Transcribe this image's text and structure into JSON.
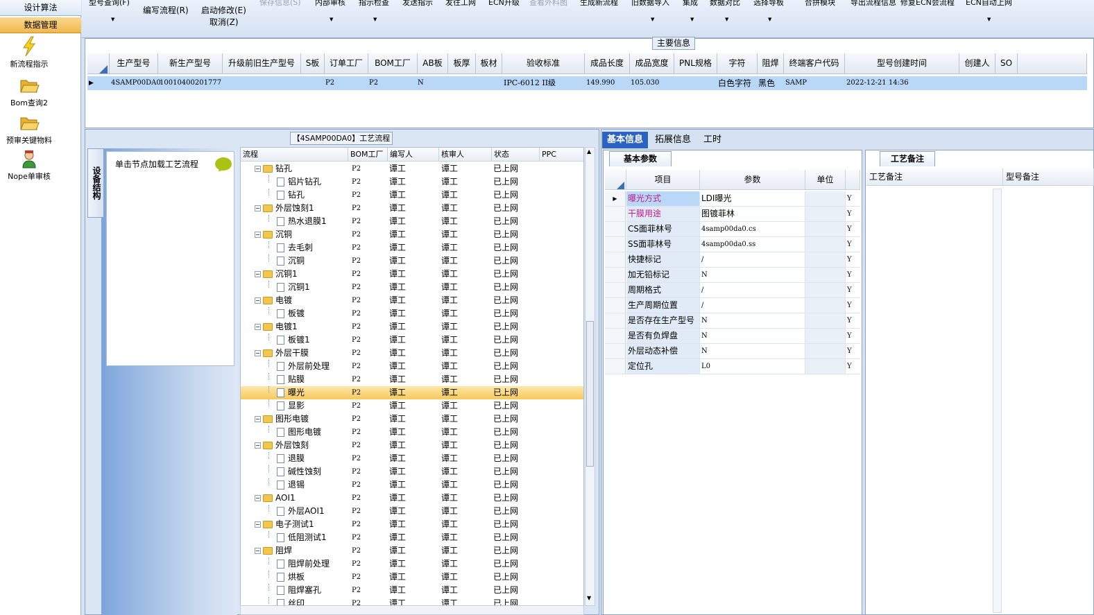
{
  "sidebar": {
    "tabs": [
      "设计算法",
      "数据管理"
    ],
    "items": [
      {
        "label": "新流程指示",
        "icon": "lightning-icon"
      },
      {
        "label": "Bom查询2",
        "icon": "folder-open-icon"
      },
      {
        "label": "预审关键物料",
        "icon": "folder-open-icon"
      },
      {
        "label": "Nope单审核",
        "icon": "user-icon"
      }
    ]
  },
  "toolbar": {
    "top_row": [
      "型号查询(F)",
      "保存信息(S)",
      "内部审核",
      "指示检查",
      "发送指示",
      "发往工网",
      "ECN升级",
      "查看外料图",
      "生成新流程",
      "旧数据导入",
      "集成",
      "数据对比",
      "选择导板",
      "合拼模块",
      "导出流程信息",
      "修复ECN会流程",
      "ECN自动上网"
    ],
    "main_row": [
      "编写流程(R)",
      "启动修改(E)",
      "取消(Z)"
    ]
  },
  "main_info": {
    "title": "主要信息",
    "columns": [
      "生产型号",
      "新生产型号",
      "升级前旧生产型号",
      "S板",
      "订单工厂",
      "BOM工厂",
      "AB板",
      "板厚",
      "板材",
      "验收标准",
      "成品长度",
      "成品宽度",
      "PNL规格",
      "字符",
      "阻焊",
      "终端客户代码",
      "型号创建时间",
      "创建人",
      "SO"
    ],
    "row": {
      "生产型号": "4SAMP00DA0",
      "新生产型号": "10010400201777",
      "升级前旧生产型号": "",
      "S板": "",
      "订单工厂": "P2",
      "BOM工厂": "P2",
      "AB板": "N",
      "板厚": "",
      "板材": "",
      "验收标准": "IPC-6012 II级",
      "成品长度": "149.990",
      "成品宽度": "105.030",
      "PNL规格": "",
      "字符": "白色字符",
      "阻焊": "黑色",
      "终端客户代码": "SAMP",
      "型号创建时间": "2022-12-21 14:36",
      "创建人": "",
      "SO": ""
    }
  },
  "process": {
    "title": "【4SAMP00DA0】工艺流程",
    "vertical_tab": "设备结构",
    "load_hint": "单击节点加载工艺流程",
    "columns": [
      "流程",
      "BOM工厂",
      "编写人",
      "核审人",
      "状态",
      "PPC"
    ],
    "rows": [
      {
        "name": "钻孔",
        "type": "folder",
        "bom": "P2",
        "writer": "谭工",
        "reviewer": "谭工",
        "status": "已上网"
      },
      {
        "name": "铝片钻孔",
        "type": "doc",
        "bom": "P2",
        "writer": "谭工",
        "reviewer": "谭工",
        "status": "已上网"
      },
      {
        "name": "钻孔",
        "type": "doc",
        "bom": "P2",
        "writer": "谭工",
        "reviewer": "谭工",
        "status": "已上网"
      },
      {
        "name": "外层蚀刻1",
        "type": "folder",
        "bom": "P2",
        "writer": "谭工",
        "reviewer": "谭工",
        "status": "已上网"
      },
      {
        "name": "热水退膜1",
        "type": "doc",
        "bom": "P2",
        "writer": "谭工",
        "reviewer": "谭工",
        "status": "已上网"
      },
      {
        "name": "沉铜",
        "type": "folder",
        "bom": "P2",
        "writer": "谭工",
        "reviewer": "谭工",
        "status": "已上网"
      },
      {
        "name": "去毛刺",
        "type": "doc",
        "bom": "P2",
        "writer": "谭工",
        "reviewer": "谭工",
        "status": "已上网"
      },
      {
        "name": "沉铜",
        "type": "doc",
        "bom": "P2",
        "writer": "谭工",
        "reviewer": "谭工",
        "status": "已上网"
      },
      {
        "name": "沉铜1",
        "type": "folder",
        "bom": "P2",
        "writer": "谭工",
        "reviewer": "谭工",
        "status": "已上网"
      },
      {
        "name": "沉铜1",
        "type": "doc",
        "bom": "P2",
        "writer": "谭工",
        "reviewer": "谭工",
        "status": "已上网"
      },
      {
        "name": "电镀",
        "type": "folder",
        "bom": "P2",
        "writer": "谭工",
        "reviewer": "谭工",
        "status": "已上网"
      },
      {
        "name": "板镀",
        "type": "doc",
        "bom": "P2",
        "writer": "谭工",
        "reviewer": "谭工",
        "status": "已上网"
      },
      {
        "name": "电镀1",
        "type": "folder",
        "bom": "P2",
        "writer": "谭工",
        "reviewer": "谭工",
        "status": "已上网"
      },
      {
        "name": "板镀1",
        "type": "doc",
        "bom": "P2",
        "writer": "谭工",
        "reviewer": "谭工",
        "status": "已上网"
      },
      {
        "name": "外层干膜",
        "type": "folder",
        "bom": "P2",
        "writer": "谭工",
        "reviewer": "谭工",
        "status": "已上网"
      },
      {
        "name": "外层前处理",
        "type": "doc",
        "bom": "P2",
        "writer": "谭工",
        "reviewer": "谭工",
        "status": "已上网"
      },
      {
        "name": "贴膜",
        "type": "doc",
        "bom": "P2",
        "writer": "谭工",
        "reviewer": "谭工",
        "status": "已上网"
      },
      {
        "name": "曝光",
        "type": "doc",
        "bom": "P2",
        "writer": "谭工",
        "reviewer": "谭工",
        "status": "已上网",
        "selected": true
      },
      {
        "name": "显影",
        "type": "doc",
        "bom": "P2",
        "writer": "谭工",
        "reviewer": "谭工",
        "status": "已上网"
      },
      {
        "name": "图形电镀",
        "type": "folder",
        "bom": "P2",
        "writer": "谭工",
        "reviewer": "谭工",
        "status": "已上网"
      },
      {
        "name": "图形电镀",
        "type": "doc",
        "bom": "P2",
        "writer": "谭工",
        "reviewer": "谭工",
        "status": "已上网"
      },
      {
        "name": "外层蚀刻",
        "type": "folder",
        "bom": "P2",
        "writer": "谭工",
        "reviewer": "谭工",
        "status": "已上网"
      },
      {
        "name": "退膜",
        "type": "doc",
        "bom": "P2",
        "writer": "谭工",
        "reviewer": "谭工",
        "status": "已上网"
      },
      {
        "name": "碱性蚀刻",
        "type": "doc",
        "bom": "P2",
        "writer": "谭工",
        "reviewer": "谭工",
        "status": "已上网"
      },
      {
        "name": "退锡",
        "type": "doc",
        "bom": "P2",
        "writer": "谭工",
        "reviewer": "谭工",
        "status": "已上网"
      },
      {
        "name": "AOI1",
        "type": "folder",
        "bom": "P2",
        "writer": "谭工",
        "reviewer": "谭工",
        "status": "已上网"
      },
      {
        "name": "外层AOI1",
        "type": "doc",
        "bom": "P2",
        "writer": "谭工",
        "reviewer": "谭工",
        "status": "已上网"
      },
      {
        "name": "电子测试1",
        "type": "folder",
        "bom": "P2",
        "writer": "谭工",
        "reviewer": "谭工",
        "status": "已上网"
      },
      {
        "name": "低阻测试1",
        "type": "doc",
        "bom": "P2",
        "writer": "谭工",
        "reviewer": "谭工",
        "status": "已上网"
      },
      {
        "name": "阻焊",
        "type": "folder",
        "bom": "P2",
        "writer": "谭工",
        "reviewer": "谭工",
        "status": "已上网"
      },
      {
        "name": "阻焊前处理",
        "type": "doc",
        "bom": "P2",
        "writer": "谭工",
        "reviewer": "谭工",
        "status": "已上网"
      },
      {
        "name": "烘板",
        "type": "doc",
        "bom": "P2",
        "writer": "谭工",
        "reviewer": "谭工",
        "status": "已上网"
      },
      {
        "name": "阻焊塞孔",
        "type": "doc",
        "bom": "P2",
        "writer": "谭工",
        "reviewer": "谭工",
        "status": "已上网"
      },
      {
        "name": "丝印",
        "type": "doc",
        "bom": "P2",
        "writer": "谭工",
        "reviewer": "谭工",
        "status": "已上网"
      }
    ]
  },
  "right": {
    "tabs": [
      "基本信息",
      "拓展信息",
      "工时"
    ],
    "param_tab": "基本参数",
    "param_columns": [
      "项目",
      "参数",
      "单位"
    ],
    "params": [
      {
        "item": "曝光方式",
        "value": "LDI曝光",
        "flag": "Y",
        "pink": true,
        "selected": true
      },
      {
        "item": "干膜用途",
        "value": "图镀菲林",
        "flag": "Y",
        "pink": true
      },
      {
        "item": "CS面菲林号",
        "value": "4samp00da0.cs",
        "flag": "Y"
      },
      {
        "item": "SS面菲林号",
        "value": "4samp00da0.ss",
        "flag": "Y"
      },
      {
        "item": "快捷标记",
        "value": "/",
        "flag": "Y"
      },
      {
        "item": "加无铅标记",
        "value": "N",
        "flag": "Y"
      },
      {
        "item": "周期格式",
        "value": "/",
        "flag": "Y"
      },
      {
        "item": "生产周期位置",
        "value": "/",
        "flag": "Y"
      },
      {
        "item": "是否存在生产型号",
        "value": "N",
        "flag": "Y"
      },
      {
        "item": "是否有负焊盘",
        "value": "N",
        "flag": "Y"
      },
      {
        "item": "外层动态补偿",
        "value": "N",
        "flag": "Y"
      },
      {
        "item": "定位孔",
        "value": "L0",
        "flag": "Y"
      }
    ],
    "note_tab": "工艺备注",
    "note_columns": [
      "工艺备注",
      "型号备注"
    ]
  }
}
